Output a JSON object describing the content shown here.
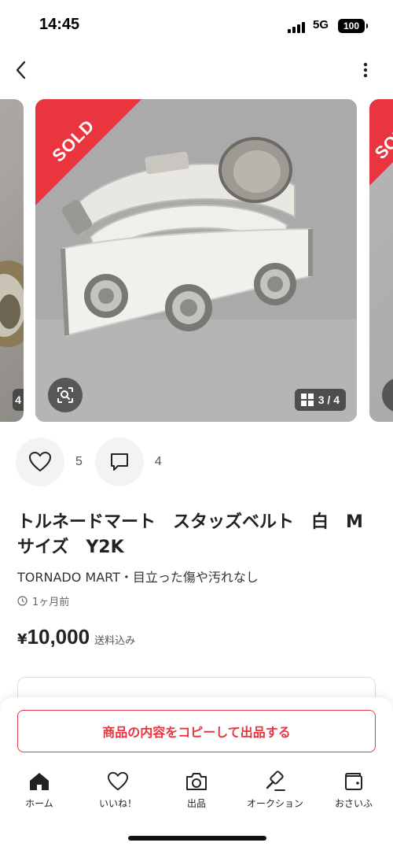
{
  "status_bar": {
    "time": "14:45",
    "network": "5G",
    "battery": "100"
  },
  "nav": {
    "back_icon": "chevron-left-icon",
    "more_icon": "vertical-ellipsis-icon"
  },
  "carousel": {
    "sold_label": "SOLD",
    "counter_main": "3 / 4",
    "counter_prev_partial": "4",
    "colors": {
      "sold_ribbon": "#e8353f"
    }
  },
  "actions": {
    "likes": "5",
    "comments": "4"
  },
  "product": {
    "title": "トルネードマート　スタッズベルト　白　Mサイズ　Y2K",
    "subtitle": "TORNADO MART・目立った傷や汚れなし",
    "posted": "1ヶ月前",
    "price_symbol": "¥",
    "price": "10,000",
    "price_note": "送料込み"
  },
  "copy_button": {
    "label": "商品の内容をコピーして出品する",
    "color": "#e8353f"
  },
  "tabs": [
    {
      "label": "ホーム",
      "icon": "home-icon"
    },
    {
      "label": "いいね！",
      "icon": "heart-icon"
    },
    {
      "label": "出品",
      "icon": "camera-icon"
    },
    {
      "label": "オークション",
      "icon": "gavel-icon"
    },
    {
      "label": "おさいふ",
      "icon": "wallet-icon"
    }
  ]
}
